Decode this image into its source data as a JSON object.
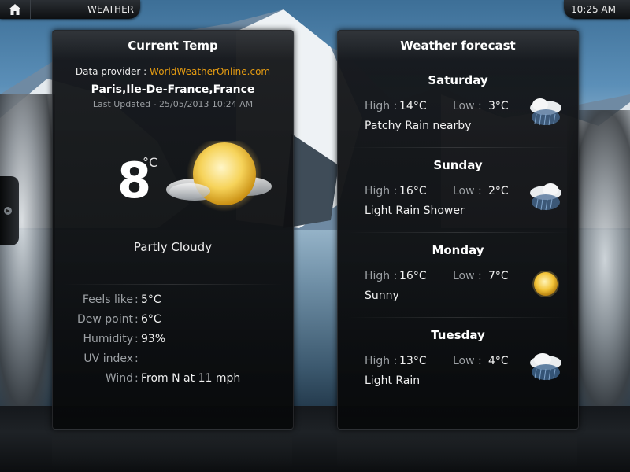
{
  "topbar": {
    "home_icon": "home-icon",
    "title": "WEATHER",
    "clock": "10:25 AM"
  },
  "current": {
    "header": "Current Temp",
    "provider_label": "Data provider :",
    "provider_name": "WorldWeatherOnline.com",
    "location": "Paris,Ile-De-France,France",
    "updated": "Last Updated - 25/05/2013 10:24 AM",
    "temperature": "8",
    "unit": "°C",
    "icon": "partly-cloudy-icon",
    "condition": "Partly Cloudy",
    "details": [
      {
        "label": "Feels like",
        "value": "5°C"
      },
      {
        "label": "Dew point",
        "value": "6°C"
      },
      {
        "label": "Humidity",
        "value": "93%"
      },
      {
        "label": "UV index",
        "value": ""
      },
      {
        "label": "Wind",
        "value": "From N at 11 mph"
      }
    ]
  },
  "forecast": {
    "header": "Weather forecast",
    "high_label": "High :",
    "low_label": "Low :",
    "days": [
      {
        "name": "Saturday",
        "high": "14°C",
        "low": "3°C",
        "condition": "Patchy Rain nearby",
        "icon": "rain-cloud-icon"
      },
      {
        "name": "Sunday",
        "high": "16°C",
        "low": "2°C",
        "condition": "Light Rain Shower",
        "icon": "rain-cloud-icon"
      },
      {
        "name": "Monday",
        "high": "16°C",
        "low": "7°C",
        "condition": "Sunny",
        "icon": "sun-icon"
      },
      {
        "name": "Tuesday",
        "high": "13°C",
        "low": "4°C",
        "condition": "Light Rain",
        "icon": "rain-cloud-icon"
      }
    ]
  },
  "colors": {
    "provider_link": "#e59b12",
    "label_gray": "#9ca0a4"
  }
}
